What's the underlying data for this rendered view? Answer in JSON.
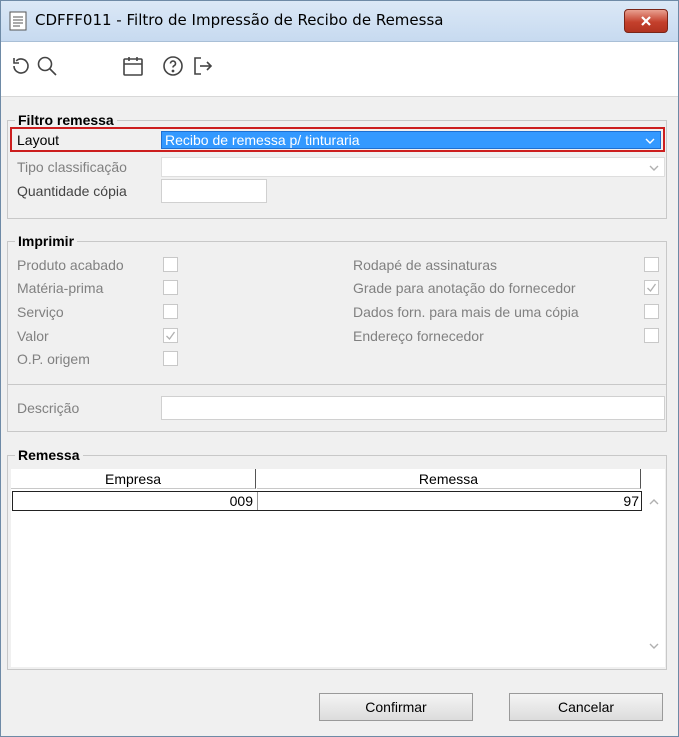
{
  "window": {
    "title": "CDFFF011 - Filtro de Impressão de Recibo de Remessa"
  },
  "toolbar": {
    "icons": [
      "refresh-icon",
      "search-icon",
      "calendar-icon",
      "help-icon",
      "exit-icon"
    ]
  },
  "filtro": {
    "legend": "Filtro remessa",
    "layout_label": "Layout",
    "layout_value": "Recibo de remessa p/ tinturaria",
    "tipo_label": "Tipo classificação",
    "tipo_value": "",
    "quantidade_label": "Quantidade cópia",
    "quantidade_value": ""
  },
  "imprimir": {
    "legend": "Imprimir",
    "left_options": [
      {
        "label": "Produto acabado",
        "checked": false
      },
      {
        "label": "Matéria-prima",
        "checked": false
      },
      {
        "label": "Serviço",
        "checked": false
      },
      {
        "label": "Valor",
        "checked": true
      },
      {
        "label": "O.P. origem",
        "checked": false
      }
    ],
    "right_options": [
      {
        "label": "Rodapé de assinaturas",
        "checked": false
      },
      {
        "label": "Grade para anotação do fornecedor",
        "checked": true
      },
      {
        "label": "Dados forn. para mais de uma cópia",
        "checked": false
      },
      {
        "label": "Endereço fornecedor",
        "checked": false
      }
    ],
    "descricao_label": "Descrição",
    "descricao_value": ""
  },
  "remessa": {
    "legend": "Remessa",
    "columns": [
      "Empresa",
      "Remessa"
    ],
    "rows": [
      {
        "empresa": "009",
        "remessa": "97"
      }
    ]
  },
  "buttons": {
    "confirm": "Confirmar",
    "cancel": "Cancelar"
  },
  "colors": {
    "selection": "#3399ff",
    "highlight_border": "#cc1e1e"
  }
}
